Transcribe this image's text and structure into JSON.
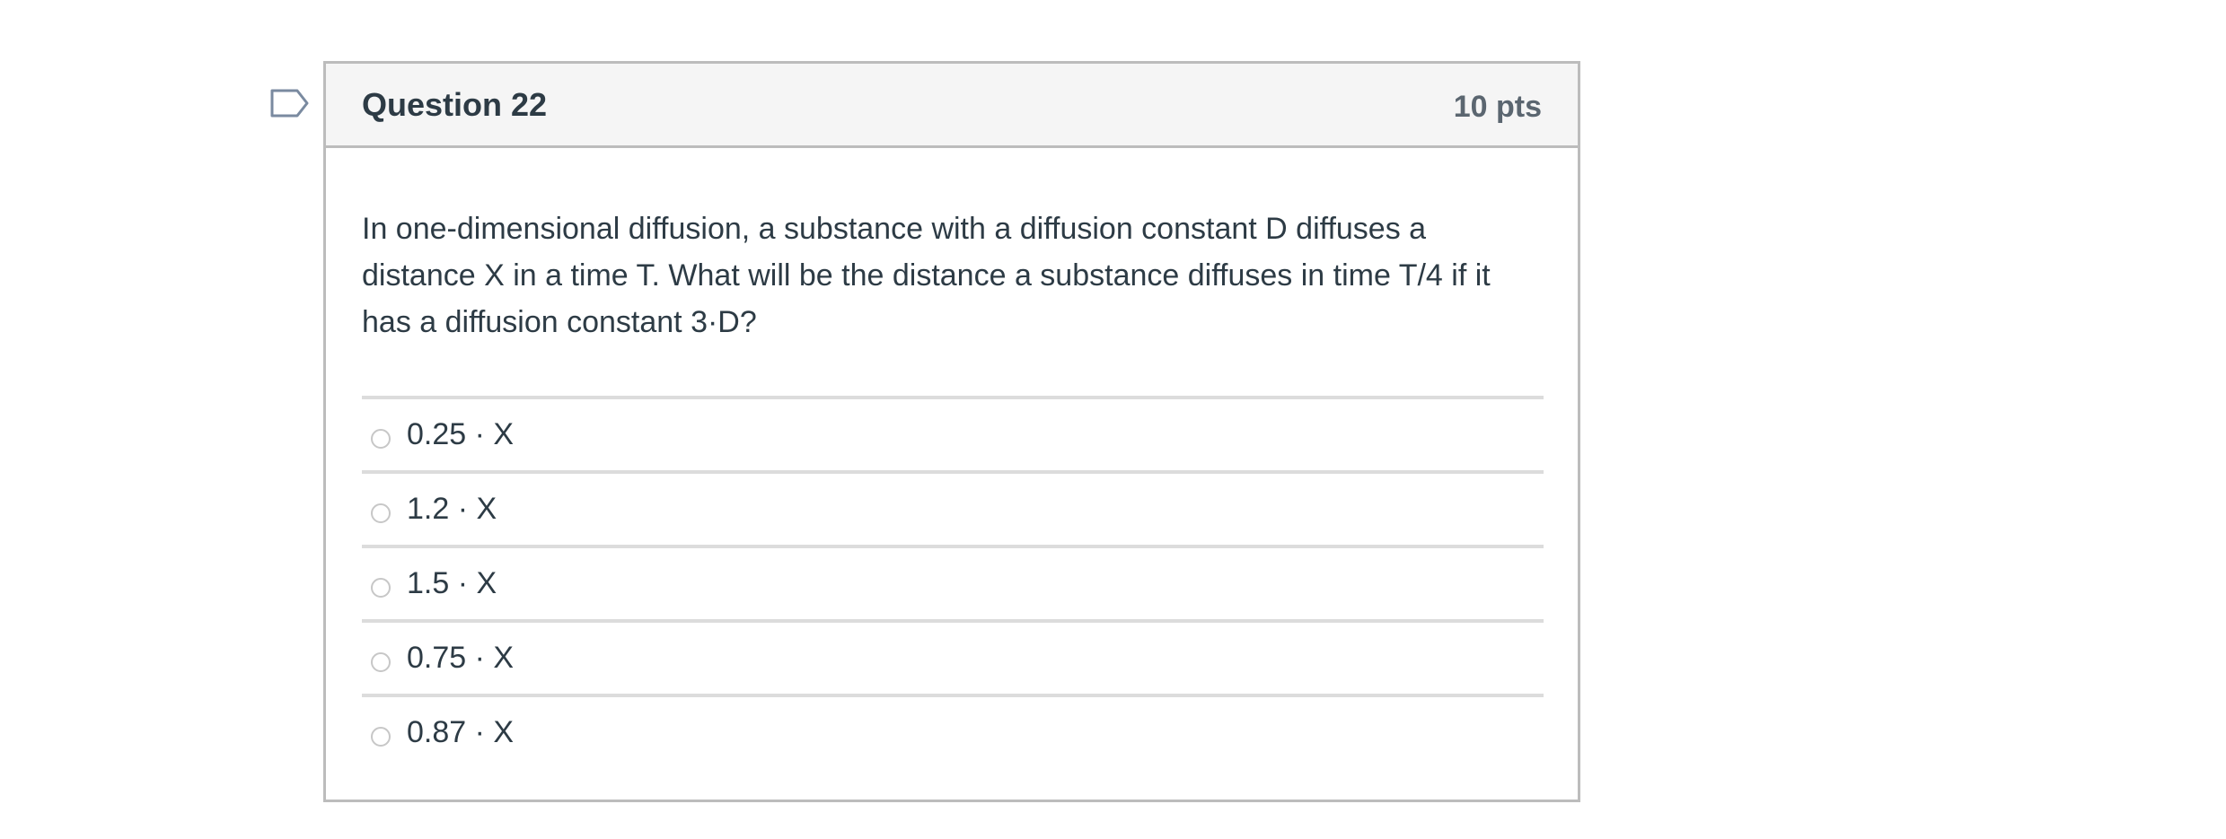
{
  "question": {
    "title": "Question 22",
    "points": "10 pts",
    "text": "In one-dimensional diffusion, a substance with a diffusion constant D diffuses a distance X in a time T.  What will be the distance a substance diffuses in time T/4 if it has a diffusion constant 3·D?"
  },
  "answers": [
    {
      "label": "0.25 · X"
    },
    {
      "label": "1.2 · X"
    },
    {
      "label": "1.5 · X"
    },
    {
      "label": "0.75 · X"
    },
    {
      "label": "0.87 · X"
    }
  ],
  "icons": {
    "flag": "flag-bookmark-icon"
  },
  "colors": {
    "header_bg": "#f5f5f5",
    "border": "#bcbcbc",
    "text": "#2d3b45",
    "flag_stroke": "#7a8aa0"
  }
}
